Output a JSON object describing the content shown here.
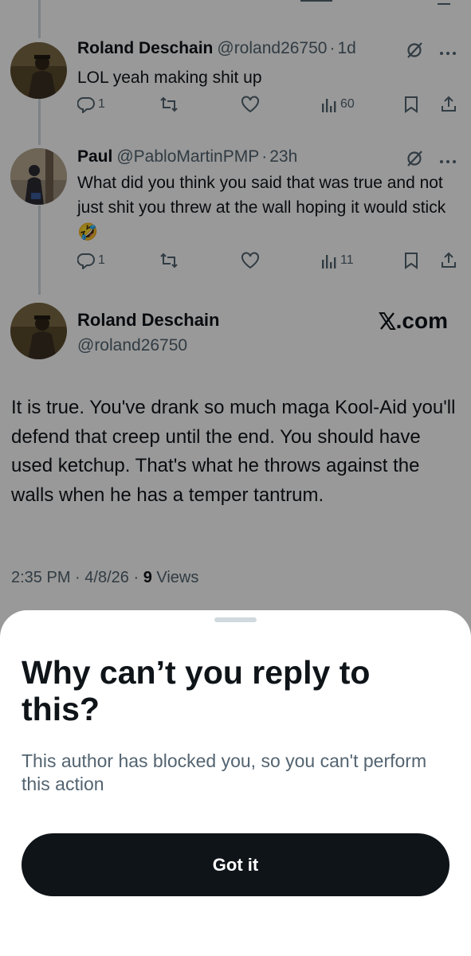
{
  "tweets": [
    {
      "name": "Roland Deschain",
      "handle": "@roland26750",
      "time": "1d",
      "text": "LOL yeah making shit up",
      "reply_count": "1",
      "view_count": "60"
    },
    {
      "name": "Paul",
      "handle": "@PabloMartinPMP",
      "time": "23h",
      "text": "What did you think you said that was true and not just shit you threw at the wall hoping it would stick 🤣",
      "reply_count": "1",
      "view_count": "11"
    }
  ],
  "main_tweet": {
    "name": "Roland Deschain",
    "handle": "@roland26750",
    "source_label": ".com",
    "text": "It is true. You've drank so much maga Kool-Aid you'll defend that creep until the end. You should have used ketchup. That's what he throws against the walls when he has a temper tantrum.",
    "time": "2:35 PM",
    "date": "4/8/26",
    "views_count": "9",
    "views_label": "Views"
  },
  "separator": "·",
  "sheet": {
    "title": "Why can’t you reply to this?",
    "description": "This author has blocked you, so you can't perform this action",
    "button_label": "Got it"
  },
  "colors": {
    "text": "#0f1419",
    "secondary": "#536471",
    "button": "#0f1419",
    "overlay": "rgba(0,0,0,0.40)"
  },
  "icons": [
    "reply-icon",
    "retweet-icon",
    "like-icon",
    "views-icon",
    "bookmark-icon",
    "share-icon",
    "grok-icon",
    "more-icon",
    "x-logo-icon"
  ]
}
